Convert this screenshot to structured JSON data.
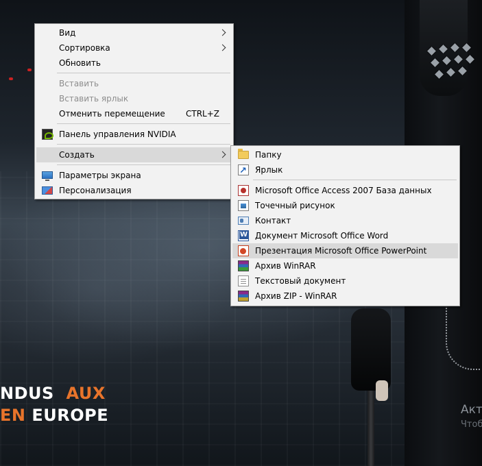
{
  "desktop": {
    "promo_line1_prefix": "NDUS",
    "promo_line1_accent": "AUX",
    "promo_line2_accent": "EN",
    "promo_line2_suffix": "EUROPE",
    "side_text": "Акт",
    "side_text_small": "Чтоб",
    "colors": {
      "accent": "#e8742b",
      "menu_bg": "#f2f2f2",
      "menu_hover": "#d9d9d9"
    }
  },
  "context_menu": {
    "items": [
      {
        "label": "Вид",
        "has_submenu": true
      },
      {
        "label": "Сортировка",
        "has_submenu": true
      },
      {
        "label": "Обновить"
      },
      {
        "label": "Вставить",
        "disabled": true
      },
      {
        "label": "Вставить ярлык",
        "disabled": true
      },
      {
        "label": "Отменить перемещение",
        "shortcut": "CTRL+Z"
      },
      {
        "label": "Панель управления NVIDIA",
        "icon": "nvidia-icon"
      },
      {
        "label": "Создать",
        "has_submenu": true,
        "highlighted": true
      },
      {
        "label": "Параметры экрана",
        "icon": "display-settings-icon"
      },
      {
        "label": "Персонализация",
        "icon": "personalization-icon"
      }
    ]
  },
  "create_submenu": {
    "items": [
      {
        "label": "Папку",
        "icon": "folder-icon"
      },
      {
        "label": "Ярлык",
        "icon": "shortcut-icon"
      },
      {
        "label": "Microsoft Office Access 2007 База данных",
        "icon": "access-icon"
      },
      {
        "label": "Точечный рисунок",
        "icon": "bitmap-icon"
      },
      {
        "label": "Контакт",
        "icon": "contact-icon"
      },
      {
        "label": "Документ Microsoft Office Word",
        "icon": "word-icon"
      },
      {
        "label": "Презентация Microsoft Office PowerPoint",
        "icon": "powerpoint-icon",
        "highlighted": true
      },
      {
        "label": "Архив WinRAR",
        "icon": "winrar-icon"
      },
      {
        "label": "Текстовый документ",
        "icon": "text-document-icon"
      },
      {
        "label": "Архив ZIP - WinRAR",
        "icon": "zip-winrar-icon"
      }
    ]
  }
}
